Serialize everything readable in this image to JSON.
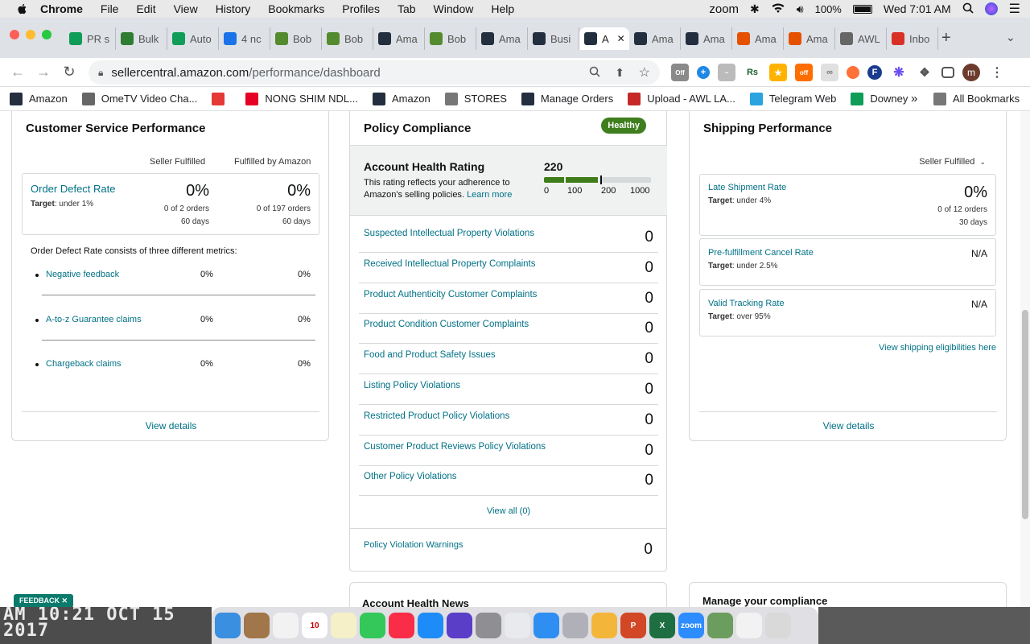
{
  "menubar": {
    "app_name": "Chrome",
    "menus": [
      "File",
      "Edit",
      "View",
      "History",
      "Bookmarks",
      "Profiles",
      "Tab",
      "Window",
      "Help"
    ],
    "status_zoom": "zoom",
    "battery": "100%",
    "clock": "Wed 7:01 AM"
  },
  "tabs": [
    {
      "label": "PR s",
      "icon": "sheets-icon",
      "color": "#0f9d58"
    },
    {
      "label": "Bulk",
      "icon": "bulk-icon",
      "color": "#2e7d32"
    },
    {
      "label": "Auto",
      "icon": "sheets-icon",
      "color": "#0f9d58"
    },
    {
      "label": "4 nc",
      "icon": "badge-icon",
      "color": "#1a73e8"
    },
    {
      "label": "Bob",
      "icon": "bob-icon",
      "color": "#558b2f"
    },
    {
      "label": "Bob",
      "icon": "bob-icon",
      "color": "#558b2f"
    },
    {
      "label": "Ama",
      "icon": "amazon-icon",
      "color": "#232f3e"
    },
    {
      "label": "Bob",
      "icon": "bob-icon",
      "color": "#558b2f"
    },
    {
      "label": "Ama",
      "icon": "amazon-icon",
      "color": "#232f3e"
    },
    {
      "label": "Busi",
      "icon": "amazon-icon",
      "color": "#232f3e"
    },
    {
      "label": "A",
      "icon": "amazon-icon",
      "color": "#232f3e",
      "active": true
    },
    {
      "label": "Ama",
      "icon": "amazon-icon",
      "color": "#232f3e"
    },
    {
      "label": "Ama",
      "icon": "amazon-icon",
      "color": "#232f3e"
    },
    {
      "label": "Ama",
      "icon": "amazon-orange-icon",
      "color": "#e65100"
    },
    {
      "label": "Ama",
      "icon": "amazon-orange-icon",
      "color": "#e65100"
    },
    {
      "label": "AWL",
      "icon": "globe-icon",
      "color": "#666666"
    },
    {
      "label": "Inbo",
      "icon": "gmail-icon",
      "color": "#d93025"
    }
  ],
  "address": {
    "host": "sellercentral.amazon.com",
    "path": "/performance/dashboard"
  },
  "bookmarks": [
    {
      "label": "Amazon",
      "icon": "amazon-icon",
      "color": "#232f3e"
    },
    {
      "label": "OmeTV Video Cha...",
      "icon": "globe-icon",
      "color": "#666666"
    },
    {
      "label": "",
      "icon": "gift-icon",
      "color": "#e53935"
    },
    {
      "label": "NONG SHIM NDL...",
      "icon": "pinterest-icon",
      "color": "#e60023"
    },
    {
      "label": "Amazon",
      "icon": "amazon-icon",
      "color": "#232f3e"
    },
    {
      "label": "STORES",
      "icon": "folder-icon",
      "color": "#777777"
    },
    {
      "label": "Manage Orders",
      "icon": "amazon-icon",
      "color": "#232f3e"
    },
    {
      "label": "Upload - AWL LA...",
      "icon": "upload-icon",
      "color": "#c62828"
    },
    {
      "label": "Telegram Web",
      "icon": "telegram-icon",
      "color": "#2aa3df"
    },
    {
      "label": "Downey",
      "icon": "sheets-icon",
      "color": "#0f9d58"
    }
  ],
  "all_bookmarks": "All Bookmarks",
  "csp": {
    "title": "Customer Service Performance",
    "col1": "Seller Fulfilled",
    "col2": "Fulfilled by Amazon",
    "odr_label": "Order Defect Rate",
    "odr_target_label": "Target",
    "odr_target": ": under 1%",
    "sf_value": "0%",
    "sf_orders": "0 of 2 orders",
    "sf_days": "60 days",
    "fba_value": "0%",
    "fba_orders": "0 of 197 orders",
    "fba_days": "60 days",
    "consists": "Order Defect Rate consists of three different metrics:",
    "metrics": [
      {
        "label": "Negative feedback",
        "sf": "0%",
        "fba": "0%"
      },
      {
        "label": "A-to-z Guarantee claims",
        "sf": "0%",
        "fba": "0%"
      },
      {
        "label": "Chargeback claims",
        "sf": "0%",
        "fba": "0%"
      }
    ],
    "view_details": "View details"
  },
  "policy": {
    "title": "Policy Compliance",
    "badge": "Healthy",
    "ahr_title": "Account Health Rating",
    "ahr_desc1": "This rating reflects your adherence to",
    "ahr_desc2": "Amazon's selling policies.",
    "learn_more": "Learn more",
    "rating": "220",
    "scale": [
      "0",
      "100",
      "200",
      "1000"
    ],
    "rows": [
      {
        "label": "Suspected Intellectual Property Violations",
        "value": "0"
      },
      {
        "label": "Received Intellectual Property Complaints",
        "value": "0"
      },
      {
        "label": "Product Authenticity Customer Complaints",
        "value": "0"
      },
      {
        "label": "Product Condition Customer Complaints",
        "value": "0"
      },
      {
        "label": "Food and Product Safety Issues",
        "value": "0"
      },
      {
        "label": "Listing Policy Violations",
        "value": "0"
      },
      {
        "label": "Restricted Product Policy Violations",
        "value": "0"
      },
      {
        "label": "Customer Product Reviews Policy Violations",
        "value": "0"
      },
      {
        "label": "Other Policy Violations",
        "value": "0"
      }
    ],
    "view_all": "View all (0)",
    "warnings_label": "Policy Violation Warnings",
    "warnings_value": "0"
  },
  "shipping": {
    "title": "Shipping Performance",
    "filter": "Seller Fulfilled",
    "items": [
      {
        "label": "Late Shipment Rate",
        "target": ": under 4%",
        "value": "0%",
        "sub1": "0 of 12 orders",
        "sub2": "30 days"
      },
      {
        "label": "Pre-fulfillment Cancel Rate",
        "target": ": under 2.5%",
        "value": "N/A",
        "sub1": "",
        "sub2": ""
      },
      {
        "label": "Valid Tracking Rate",
        "target": ": over 95%",
        "value": "N/A",
        "sub1": "",
        "sub2": ""
      }
    ],
    "target_label": "Target",
    "eligibilities": "View shipping eligibilities here",
    "view_details": "View details"
  },
  "account_news": "Account Health News",
  "manage_compliance": "Manage your compliance",
  "feedback": "FEEDBACK",
  "desktop_text": "AM 10:21 OCT 15 2017",
  "dock": [
    {
      "name": "finder-icon",
      "color": "#3b8fe0",
      "label": ""
    },
    {
      "name": "notes-icon",
      "color": "#a0764a",
      "label": ""
    },
    {
      "name": "reminders-icon",
      "color": "#f2f2f2",
      "label": ""
    },
    {
      "name": "calendar-icon",
      "color": "#ffffff",
      "label": "10"
    },
    {
      "name": "stickies-icon",
      "color": "#f5f0c8",
      "label": ""
    },
    {
      "name": "facetime-icon",
      "color": "#34c759",
      "label": ""
    },
    {
      "name": "music-icon",
      "color": "#fa2d48",
      "label": ""
    },
    {
      "name": "appstore-icon",
      "color": "#1d8cf8",
      "label": ""
    },
    {
      "name": "siri-icon",
      "color": "#5a3ec8",
      "label": ""
    },
    {
      "name": "settings-icon",
      "color": "#8e8e93",
      "label": ""
    },
    {
      "name": "chrome-icon",
      "color": "#e8eaed",
      "label": ""
    },
    {
      "name": "safari-icon",
      "color": "#2e8ef2",
      "label": ""
    },
    {
      "name": "launchpad-icon",
      "color": "#b0b0b8",
      "label": ""
    },
    {
      "name": "photos-icon",
      "color": "#f3b63a",
      "label": ""
    },
    {
      "name": "powerpoint-icon",
      "color": "#d24726",
      "label": "P"
    },
    {
      "name": "excel-icon",
      "color": "#1d6f42",
      "label": "X"
    },
    {
      "name": "zoom-icon",
      "color": "#2d8cff",
      "label": "zoom"
    },
    {
      "name": "preview-icon",
      "color": "#6b9e5e",
      "label": ""
    },
    {
      "name": "document-icon",
      "color": "#f2f2f2",
      "label": ""
    },
    {
      "name": "trash-icon",
      "color": "#d9d9d9",
      "label": ""
    }
  ]
}
